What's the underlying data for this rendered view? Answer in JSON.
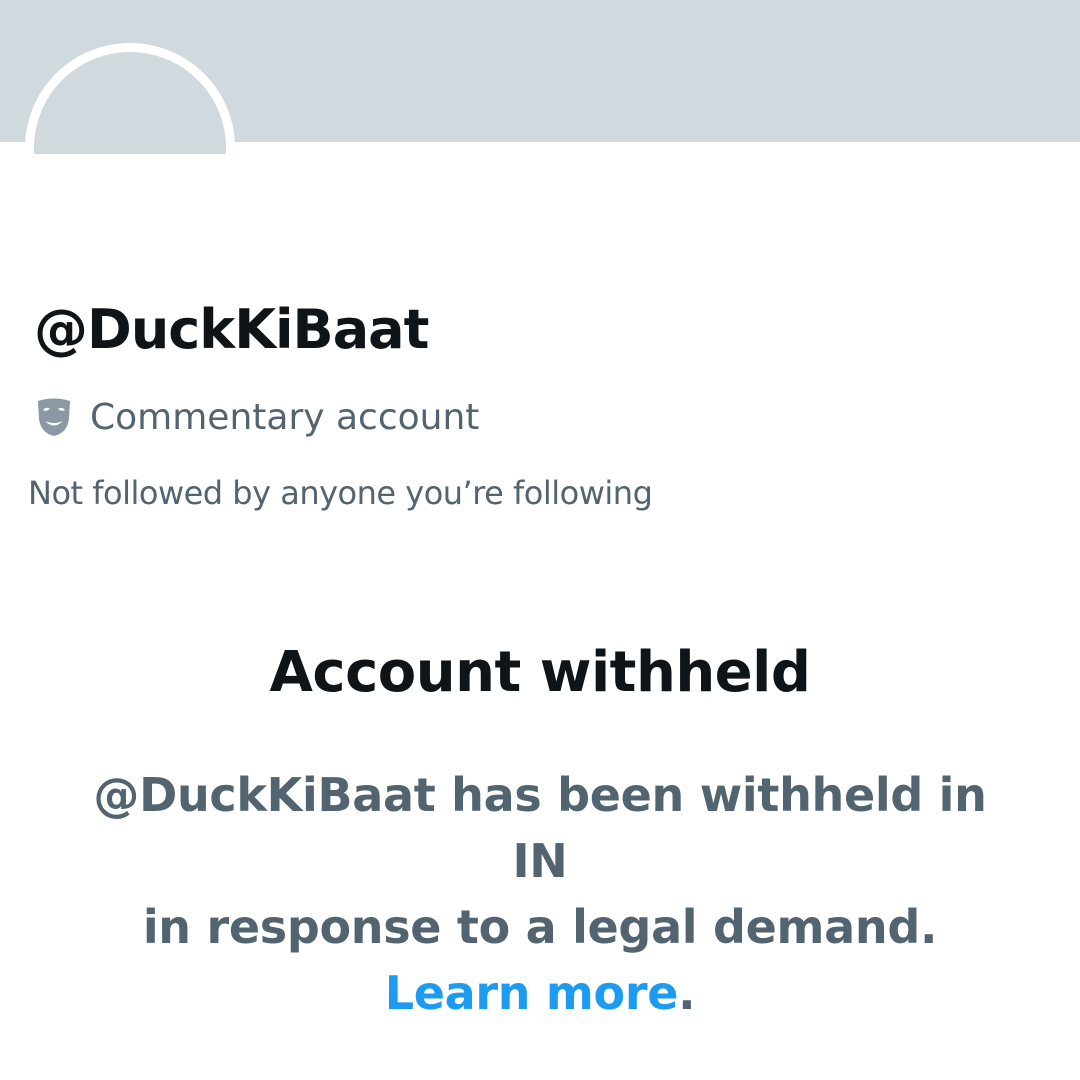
{
  "profile": {
    "handle": "@DuckKiBaat",
    "label_icon": "theater-masks-icon",
    "label_text": "Commentary account",
    "followed_by": "Not followed by anyone you’re following"
  },
  "notice": {
    "title": "Account withheld",
    "message_line1": "@DuckKiBaat has been withheld in IN",
    "message_line2": "in response to a legal demand.",
    "link_text": "Learn more",
    "trailing_punctuation": "."
  },
  "colors": {
    "banner": "#cfd9de",
    "primary_text": "#0f1419",
    "secondary_text": "#536471",
    "link": "#1d9bf0"
  }
}
